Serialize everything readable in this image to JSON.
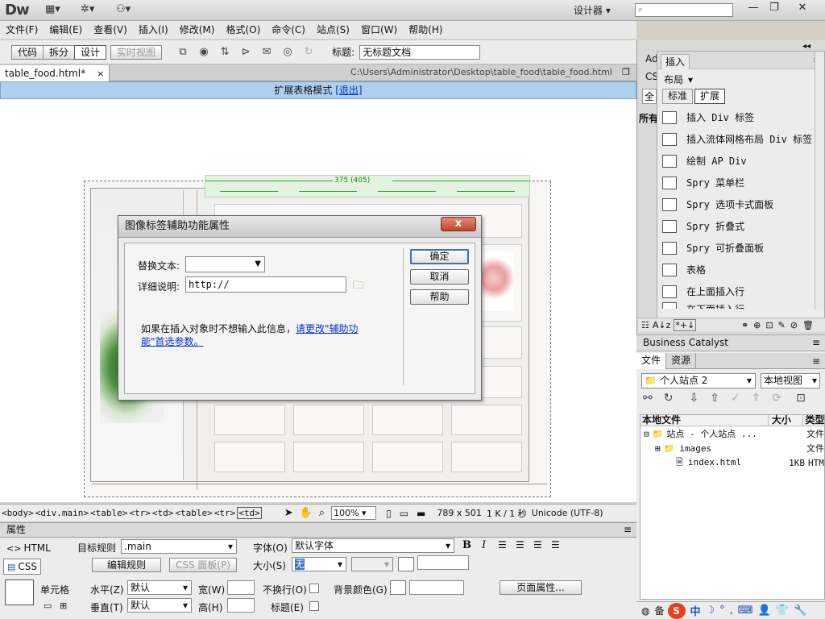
{
  "app": {
    "logo": "Dw",
    "workspace": "设计器",
    "search_placeholder": "",
    "window_min": "—",
    "window_restore": "❐",
    "window_close": "✕"
  },
  "menu": [
    "文件(F)",
    "编辑(E)",
    "查看(V)",
    "插入(I)",
    "修改(M)",
    "格式(O)",
    "命令(C)",
    "站点(S)",
    "窗口(W)",
    "帮助(H)"
  ],
  "doc_toolbar": {
    "code": "代码",
    "split": "拆分",
    "design": "设计",
    "live_view": "实时视图",
    "title_label": "标题:",
    "title_value": "无标题文档"
  },
  "doc_tab": {
    "name": "table_food.html*",
    "close": "×",
    "path": "C:\\Users\\Administrator\\Desktop\\table_food\\table_food.html"
  },
  "mode_bar": {
    "text": "扩展表格模式",
    "exit": "[退出]"
  },
  "table_width": "375 (405)",
  "status": {
    "tags": [
      "<body>",
      "<div.main>",
      "<table>",
      "<tr>",
      "<td>",
      "<table>",
      "<tr>",
      "<td>"
    ],
    "zoom": "100%",
    "dims": "789 x 501",
    "size": "1 K / 1 秒",
    "encoding": "Unicode (UTF-8)"
  },
  "props": {
    "panel_title": "属性",
    "html": "HTML",
    "css": "CSS",
    "target_rule_label": "目标规则",
    "target_rule_value": ".main",
    "edit_rule": "编辑规则",
    "css_panel": "CSS 面板(P)",
    "font_label": "字体(O)",
    "font_value": "默认字体",
    "size_label": "大小(S)",
    "size_value": "无",
    "bold": "B",
    "italic": "I",
    "cell_label": "单元格",
    "horz_label": "水平(Z)",
    "horz_value": "默认",
    "vert_label": "垂直(T)",
    "vert_value": "默认",
    "width_label": "宽(W)",
    "height_label": "高(H)",
    "nowrap_label": "不换行(O)",
    "bg_label": "背景颜色(G)",
    "header_label": "标题(E)",
    "page_props": "页面属性..."
  },
  "insert_panel": {
    "left_tabs": [
      "Ad",
      "CS",
      "全",
      "所有"
    ],
    "tab": "插入",
    "category": "布局",
    "std": "标准",
    "ext": "扩展",
    "items": [
      "插入 Div 标签",
      "插入流体网格布局 Div 标签",
      "绘制 AP Div",
      "Spry 菜单栏",
      "Spry 选项卡式面板",
      "Spry 折叠式",
      "Spry 可折叠面板",
      "表格",
      "在上面插入行",
      "在下面插入行"
    ]
  },
  "business_catalyst": "Business Catalyst",
  "files": {
    "tab_files": "文件",
    "tab_assets": "资源",
    "site": "个人站点 2",
    "view": "本地视图",
    "col_local": "本地文件",
    "col_size": "大小",
    "col_type": "类型",
    "rows": [
      {
        "name": "站点 - 个人站点 ...",
        "size": "",
        "type": "文件"
      },
      {
        "name": "images",
        "size": "",
        "type": "文件"
      },
      {
        "name": "index.html",
        "size": "1KB",
        "type": "HTM"
      }
    ]
  },
  "ime": {
    "prefix": "备",
    "sogou": "S",
    "zh": "中"
  },
  "dialog": {
    "title": "图像标签辅助功能属性",
    "close": "x",
    "alt_label": "替换文本:",
    "alt_value": "",
    "desc_label": "详细说明:",
    "desc_value": "http://",
    "ok": "确定",
    "cancel": "取消",
    "help": "帮助",
    "note": "如果在插入对象时不想输入此信息，",
    "note_link": "请更改\"辅助功能\"首选参数。"
  },
  "colors": {
    "mode_bar_bg": "#aed0ee",
    "link": "#0033cc",
    "width_guide": "#118a11"
  }
}
